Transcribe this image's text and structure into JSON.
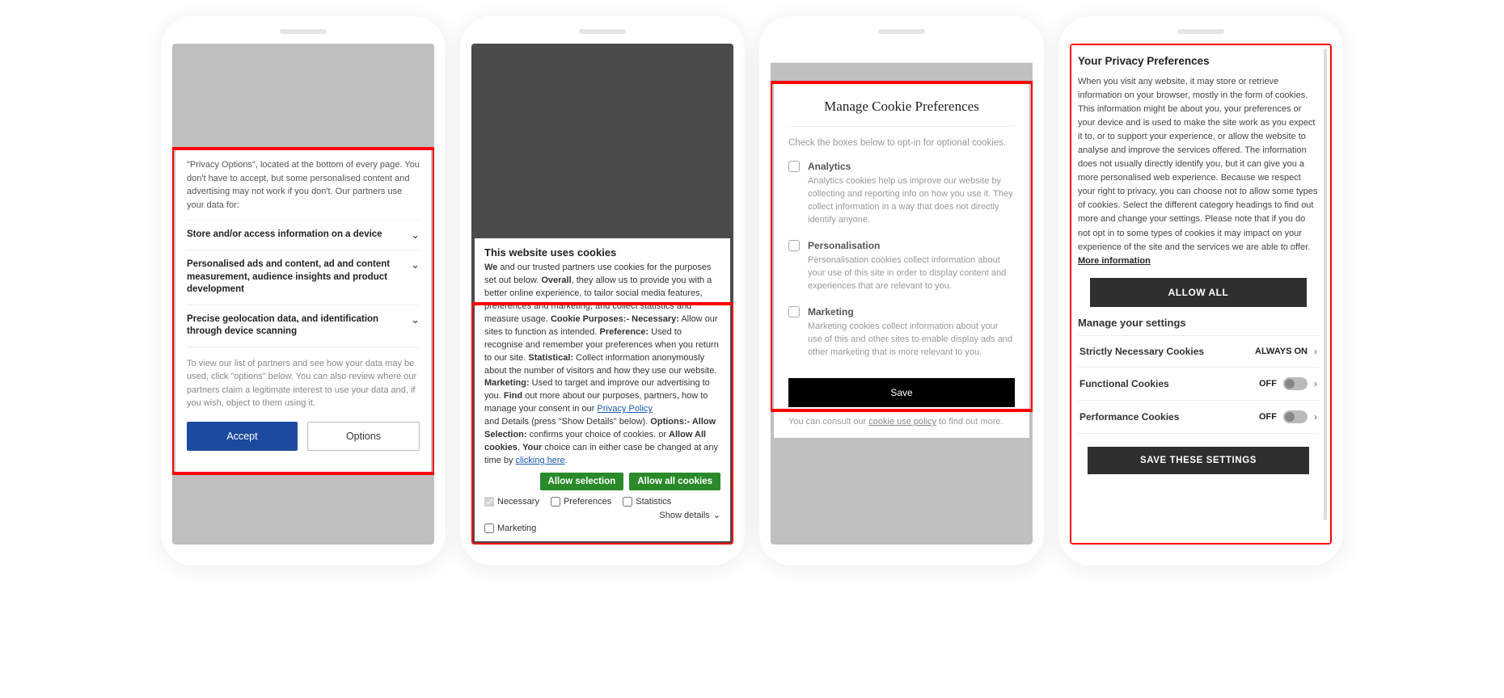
{
  "phone1": {
    "intro": "\"Privacy Options\", located at the bottom of every page. You don't have to accept, but some personalised content and advertising may not work if you don't. Our partners use your data for:",
    "rows": [
      "Store and/or access information on a device",
      "Personalised ads and content, ad and content measurement, audience insights and product development",
      "Precise geolocation data, and identification through device scanning"
    ],
    "note": "To view our list of partners and see how your data may be used, click \"options\" below. You can also review where our partners claim a legitimate interest to use your data and, if you wish, object to them using it.",
    "accept": "Accept",
    "options": "Options"
  },
  "phone2": {
    "title": "This website uses cookies",
    "we": "We",
    "t1": " and our trusted partners use cookies for the purposes set out below. ",
    "overall": "Overall",
    "t2": ", they allow us to provide you with a better online experience, to tailor social media features, preferences and marketing, and collect statistics and measure usage. ",
    "cookiep": "Cookie Purposes:- Necessary:",
    "t3": " Allow our sites to function as intended. ",
    "pref": "Preference:",
    "t4": " Used to recognise and remember your preferences when you return to our site. ",
    "stat": "Statistical:",
    "t5": " Collect information anonymously about the number of visitors and how they use our website. ",
    "mkt": "Marketing:",
    "t6": " Used to target and improve our advertising to you. ",
    "find": "Find",
    "t7": " out more about our purposes, partners, how to manage your consent in our ",
    "pp": "Privacy Policy",
    "t8": " and Details (press \"Show Details\" below). ",
    "opts": "Options:- Allow Selection:",
    "t9": " confirms your choice of cookies. or ",
    "allowall_b": "Allow All cookies",
    "t10": ". ",
    "your": "Your",
    "t11": " choice can in either case be changed at any time by ",
    "click": "clicking here",
    "t12": ".",
    "allow_selection": "Allow selection",
    "allow_all": "Allow all cookies",
    "c_necessary": "Necessary",
    "c_pref": "Preferences",
    "c_stat": "Statistics",
    "c_mkt": "Marketing",
    "show_details": "Show details"
  },
  "phone3": {
    "title": "Manage Cookie Preferences",
    "sub": "Check the boxes below to opt-in for optional cookies.",
    "items": [
      {
        "label": "Analytics",
        "desc": "Analytics cookies help us improve our website by collecting and reporting info on how you use it. They collect information in a way that does not directly identify anyone."
      },
      {
        "label": "Personalisation",
        "desc": "Personalisation cookies collect information about your use of this site in order to display content and experiences that are relevant to you."
      },
      {
        "label": "Marketing",
        "desc": "Marketing cookies collect information about your use of this and other sites to enable display ads and other marketing that is more relevant to you."
      }
    ],
    "save": "Save",
    "footer_pre": "You can consult our ",
    "footer_link": "cookie use policy",
    "footer_post": " to find out more."
  },
  "phone4": {
    "title": "Your Privacy Preferences",
    "text": "When you visit any website, it may store or retrieve information on your browser, mostly in the form of cookies. This information might be about you, your preferences or your device and is used to make the site work as you expect it to, or to support your experience, or allow the website to analyse and improve the services offered. The information does not usually directly identify you, but it can give you a more personalised web experience. Because we respect your right to privacy, you can choose not to allow some types of cookies. Select the different category headings to find out more and change your settings. Please note that if you do not opt in to some types of cookies it may impact on your experience of the site and the services we are able to offer.  ",
    "more": "More information",
    "allow_all": "ALLOW ALL",
    "manage": "Manage your settings",
    "rows": [
      {
        "label": "Strictly Necessary Cookies",
        "status": "ALWAYS ON",
        "toggle": false
      },
      {
        "label": "Functional Cookies",
        "status": "OFF",
        "toggle": true
      },
      {
        "label": "Performance Cookies",
        "status": "OFF",
        "toggle": true
      }
    ],
    "save": "SAVE THESE SETTINGS"
  }
}
